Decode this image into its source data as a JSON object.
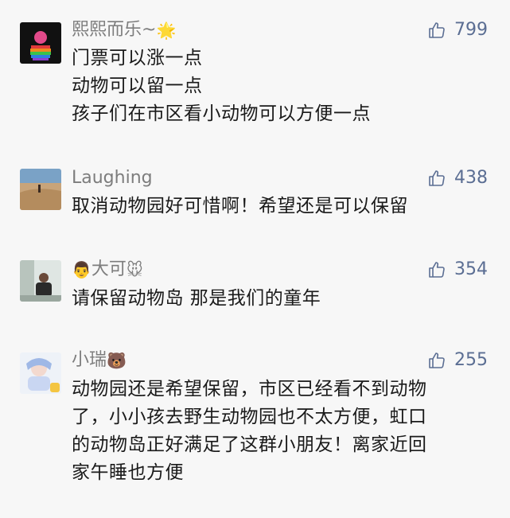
{
  "comments": [
    {
      "name": "熙熙而乐~",
      "name_emoji": "🌟",
      "likes": "799",
      "lines": [
        "门票可以涨一点",
        "动物可以留一点",
        "孩子们在市区看小动物可以方便一点"
      ]
    },
    {
      "name": "Laughing",
      "name_emoji": "",
      "likes": "438",
      "lines": [
        "取消动物园好可惜啊！希望还是可以保留"
      ]
    },
    {
      "name_prefix_emoji": "👨",
      "name": "大可",
      "name_emoji": "🐭",
      "likes": "354",
      "lines": [
        "请保留动物岛 那是我们的童年"
      ]
    },
    {
      "name": "小瑞",
      "name_emoji": "🐻",
      "likes": "255",
      "lines": [
        "动物园还是希望保留，市区已经看不到动物",
        "了，小小孩去野生动物园也不太方便，虹口",
        "的动物岛正好满足了这群小朋友！离家近回",
        "家午睡也方便"
      ]
    }
  ],
  "colors": {
    "like": "#5b6e93",
    "name": "#7d7d7d",
    "text": "#1a1a1a",
    "background": "#f7f7f7"
  },
  "icons": {
    "like": "thumbs-up-icon"
  }
}
